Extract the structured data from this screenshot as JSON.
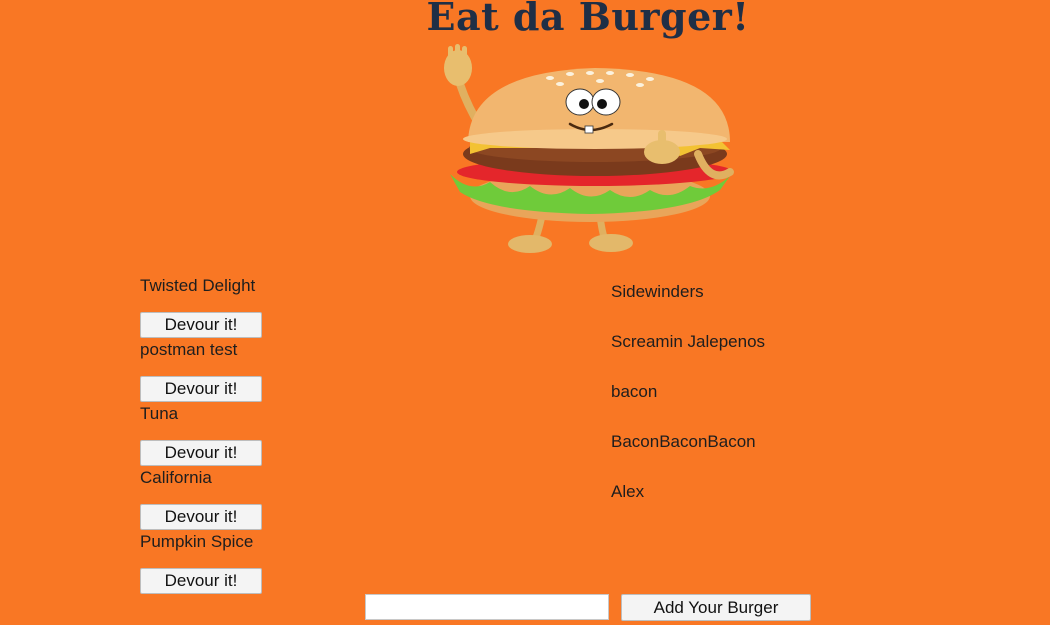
{
  "header": {
    "title": "Eat da Burger!"
  },
  "mascot": {
    "icon": "burger-mascot-icon"
  },
  "uneaten": {
    "items": [
      {
        "name": "Twisted Delight",
        "button_label": "Devour it!"
      },
      {
        "name": "postman test",
        "button_label": "Devour it!"
      },
      {
        "name": "Tuna",
        "button_label": "Devour it!"
      },
      {
        "name": "California",
        "button_label": "Devour it!"
      },
      {
        "name": "Pumpkin Spice",
        "button_label": "Devour it!"
      }
    ]
  },
  "devoured": {
    "items": [
      {
        "name": "Sidewinders"
      },
      {
        "name": "Screamin Jalepenos"
      },
      {
        "name": "bacon"
      },
      {
        "name": "BaconBaconBacon"
      },
      {
        "name": "Alex"
      }
    ]
  },
  "form": {
    "input_value": "",
    "input_placeholder": "",
    "submit_label": "Add Your Burger"
  },
  "colors": {
    "background": "#f97724",
    "title": "#1f2f46"
  }
}
